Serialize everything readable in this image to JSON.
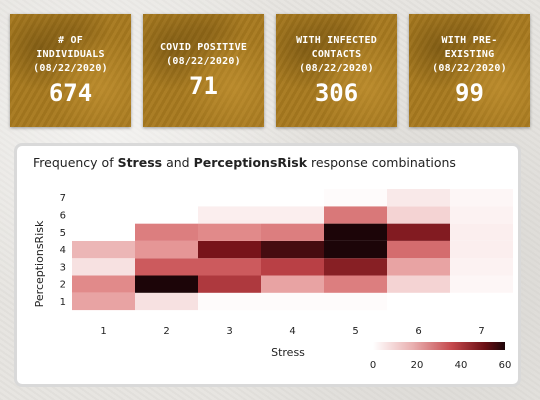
{
  "cards": [
    {
      "label": "# OF\nINDIVIDUALS\n(08/22/2020)",
      "value": "674"
    },
    {
      "label": "COVID POSITIVE\n(08/22/2020)",
      "value": "71"
    },
    {
      "label": "WITH INFECTED\nCONTACTS\n(08/22/2020)",
      "value": "306"
    },
    {
      "label": "WITH PRE-\nEXISTING\n(08/22/2020)",
      "value": "99"
    }
  ],
  "chart": {
    "title_prefix": "Frequency of ",
    "title_var1": "Stress",
    "title_mid": " and ",
    "title_var2": "PerceptionsRisk",
    "title_suffix": " response combinations"
  },
  "chart_data": {
    "type": "heatmap",
    "title": "Frequency of Stress and PerceptionsRisk response combinations",
    "xlabel": "Stress",
    "ylabel": "PerceptionsRisk",
    "x": [
      1,
      2,
      3,
      4,
      5,
      6,
      7
    ],
    "y": [
      1,
      2,
      3,
      4,
      5,
      6,
      7
    ],
    "values": [
      [
        18,
        7,
        1,
        1,
        1,
        0,
        0
      ],
      [
        22,
        65,
        37,
        18,
        24,
        10,
        2
      ],
      [
        7,
        30,
        30,
        35,
        44,
        18,
        3
      ],
      [
        15,
        20,
        47,
        54,
        65,
        27,
        4
      ],
      [
        0,
        24,
        22,
        24,
        62,
        45,
        4
      ],
      [
        0,
        0,
        4,
        4,
        25,
        10,
        3
      ],
      [
        0,
        0,
        0,
        0,
        1,
        5,
        2
      ]
    ],
    "colorbar": {
      "min": 0,
      "max": 60,
      "ticks": [
        0,
        20,
        40,
        60
      ],
      "low_color": "#ffffff",
      "high_color": "#1c0508"
    },
    "grid": false
  }
}
